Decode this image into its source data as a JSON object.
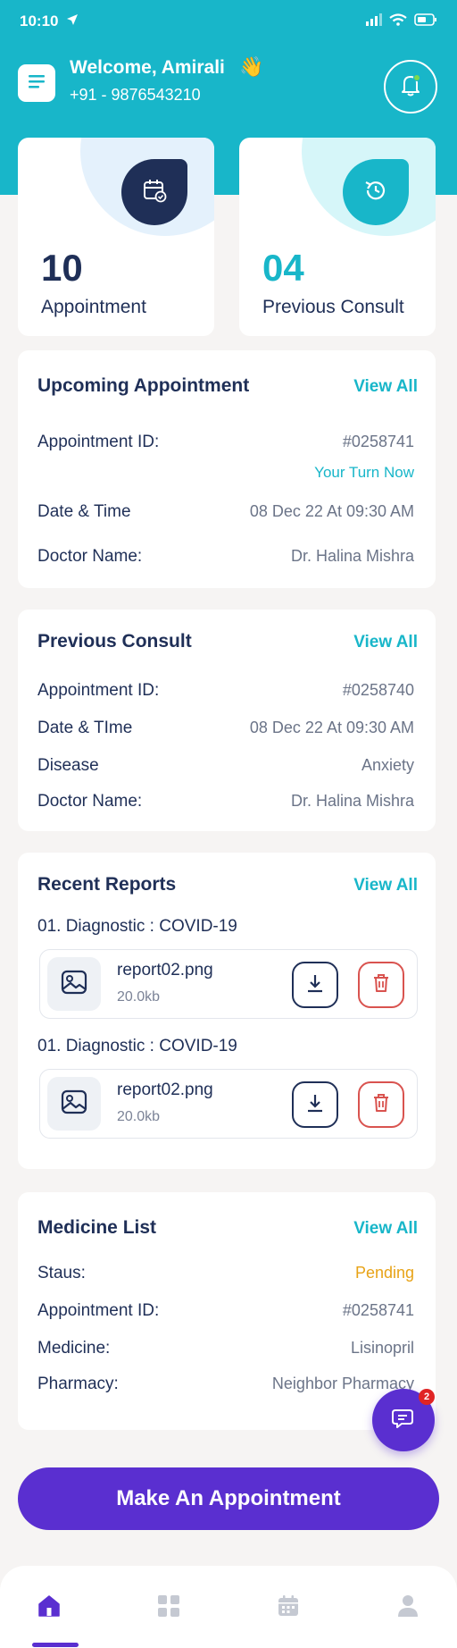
{
  "status_bar": {
    "time": "10:10"
  },
  "header": {
    "welcome": "Welcome, Amirali",
    "wave_emoji": "👋",
    "phone": "+91 - 9876543210"
  },
  "stats": [
    {
      "number": "10",
      "label": "Appointment",
      "number_color": "#1f2f57",
      "icon": "calendar-check-icon"
    },
    {
      "number": "04",
      "label": "Previous Consult",
      "number_color": "#18b6c9",
      "icon": "history-icon"
    }
  ],
  "upcoming": {
    "title": "Upcoming Appointment",
    "view_all": "View All",
    "id_label": "Appointment ID:",
    "id_value": "#0258741",
    "turn_status": "Your Turn Now",
    "date_label": "Date & Time",
    "date_value": "08 Dec 22 At 09:30 AM",
    "doctor_label": "Doctor Name:",
    "doctor_value": "Dr. Halina Mishra"
  },
  "previous": {
    "title": "Previous Consult",
    "view_all": "View All",
    "id_label": "Appointment ID:",
    "id_value": "#0258740",
    "date_label": "Date & TIme",
    "date_value": "08 Dec 22 At 09:30 AM",
    "disease_label": "Disease",
    "disease_value": "Anxiety",
    "doctor_label": "Doctor Name:",
    "doctor_value": "Dr. Halina Mishra"
  },
  "reports": {
    "title": "Recent Reports",
    "view_all": "View All",
    "items": [
      {
        "label": "01. Diagnostic : COVID-19",
        "file_name": "report02.png",
        "file_size": "20.0kb"
      },
      {
        "label": "01. Diagnostic : COVID-19",
        "file_name": "report02.png",
        "file_size": "20.0kb"
      }
    ]
  },
  "medicine": {
    "title": "Medicine List",
    "view_all": "View All",
    "status_label": "Staus:",
    "status_value": "Pending",
    "id_label": "Appointment ID:",
    "id_value": "#0258741",
    "medicine_label": "Medicine:",
    "medicine_value": "Lisinopril",
    "pharmacy_label": "Pharmacy:",
    "pharmacy_value": "Neighbor Pharmacy"
  },
  "chat": {
    "unread_count": "2"
  },
  "cta": {
    "label": "Make An Appointment"
  },
  "colors": {
    "teal": "#18b6c9",
    "navy": "#1f2f57",
    "purple": "#5a2fd0",
    "pending": "#e8a317",
    "danger": "#d9534f"
  },
  "nav": {
    "items": [
      "home-icon",
      "grid-icon",
      "calendar-icon",
      "profile-icon"
    ],
    "active": "home-icon"
  }
}
